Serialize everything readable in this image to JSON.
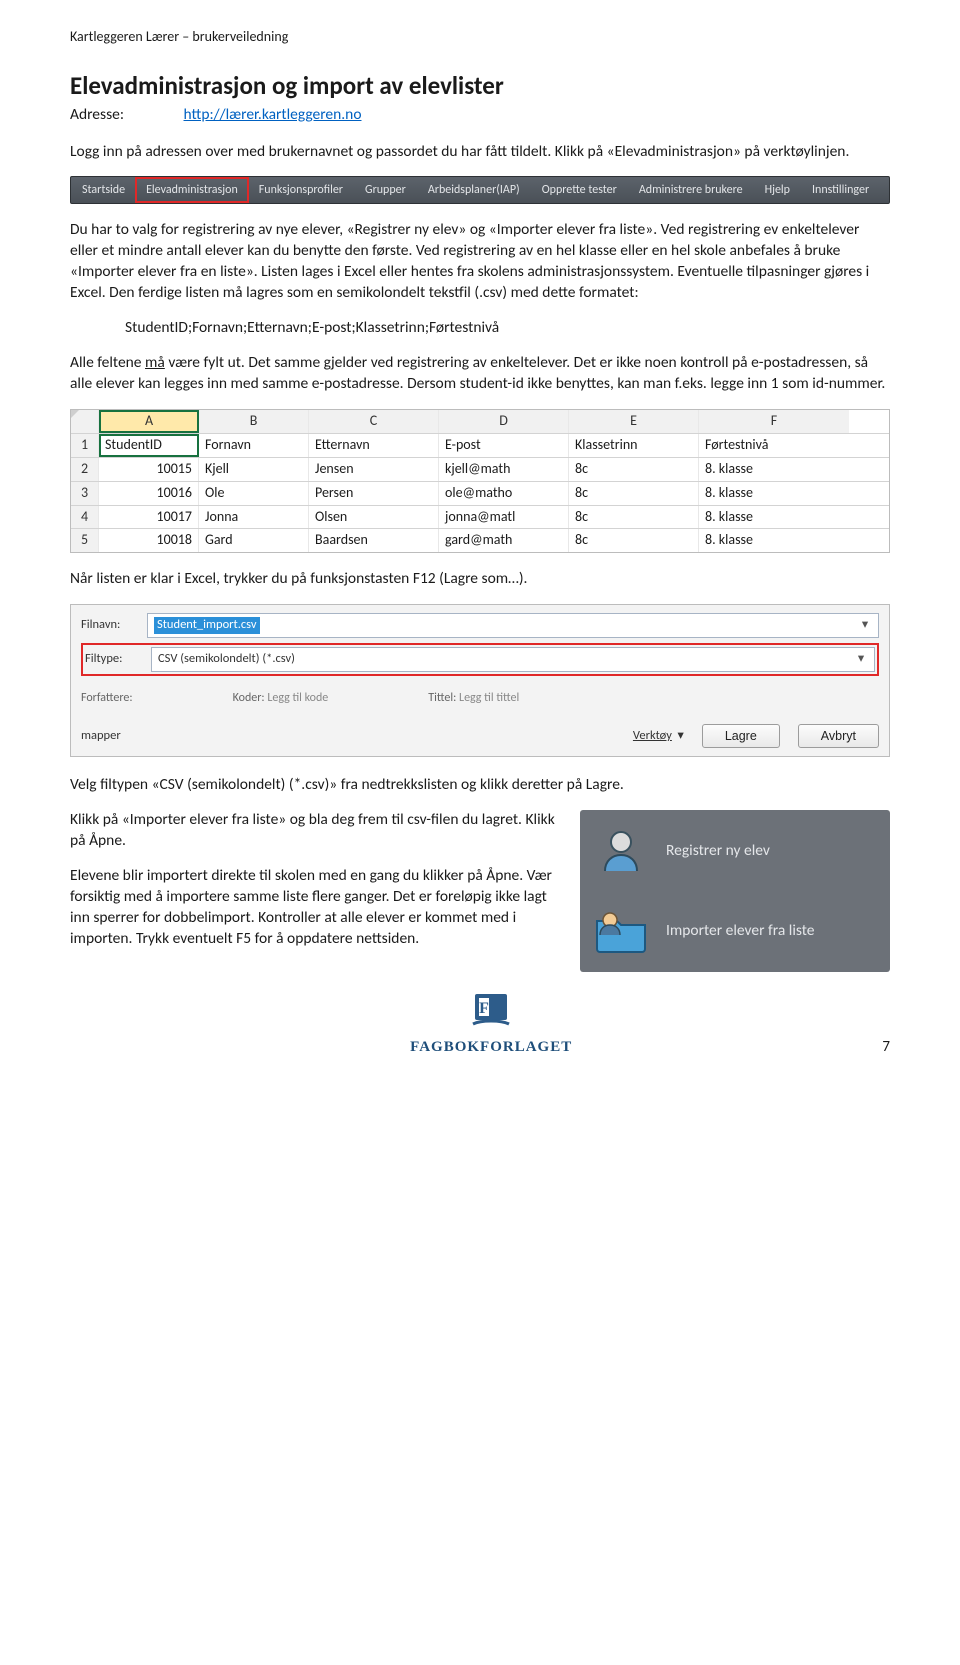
{
  "doc": {
    "header": "Kartleggeren Lærer – brukerveiledning",
    "title": "Elevadministrasjon og import av elevlister",
    "addr_label": "Adresse:",
    "addr_url": "http://lærer.kartleggeren.no",
    "intro": "Logg inn på adressen over med brukernavnet og passordet du har fått tildelt. Klikk på «Elevadministrasjon» på verktøylinjen."
  },
  "toolbar": {
    "items": [
      "Startside",
      "Elevadministrasjon",
      "Funksjonsprofiler",
      "Grupper",
      "Arbeidsplaner(IAP)",
      "Opprette tester",
      "Administrere brukere",
      "Hjelp",
      "Innstillinger"
    ]
  },
  "para1": "Du har to valg for registrering av nye elever, «Registrer ny elev» og «Importer elever fra liste». Ved registrering ev enkeltelever eller et mindre antall elever kan du benytte den første. Ved registrering av en hel klasse eller en hel skole anbefales å bruke «Importer elever fra en liste». Listen lages i Excel eller hentes fra skolens administrasjonssystem. Eventuelle tilpasninger gjøres i Excel. Den ferdige listen må lagres som en semikolondelt tekstfil (.csv) med dette formatet:",
  "csvline": "StudentID;Fornavn;Etternavn;E-post;Klassetrinn;Førtestnivå",
  "para2_a": "Alle feltene ",
  "para2_u": "må",
  "para2_b": " være fylt ut. Det samme gjelder ved registrering av enkeltelever. Det er ikke noen kontroll på e-postadressen, så alle elever kan legges inn med samme e-postadresse. Dersom student-id ikke benyttes, kan man f.eks. legge inn 1 som id-nummer.",
  "excel": {
    "cols": [
      "A",
      "B",
      "C",
      "D",
      "E",
      "F"
    ],
    "header": [
      "StudentID",
      "Fornavn",
      "Etternavn",
      "E-post",
      "Klassetrinn",
      "Førtestnivå"
    ],
    "rows": [
      [
        "10015",
        "Kjell",
        "Jensen",
        "kjell@math",
        "8c",
        "8. klasse"
      ],
      [
        "10016",
        "Ole",
        "Persen",
        "ole@matho",
        "8c",
        "8. klasse"
      ],
      [
        "10017",
        "Jonna",
        "Olsen",
        "jonna@matl",
        "8c",
        "8. klasse"
      ],
      [
        "10018",
        "Gard",
        "Baardsen",
        "gard@math",
        "8c",
        "8. klasse"
      ]
    ]
  },
  "para3": "Når listen er klar i Excel, trykker du på funksjonstasten F12 (Lagre som…).",
  "savedlg": {
    "filnavn_label": "Filnavn:",
    "filnavn_value": "Student_import.csv",
    "filtype_label": "Filtype:",
    "filtype_value": "CSV (semikolondelt) (*.csv)",
    "authors_lbl": "Forfattere:",
    "koder_lbl": "Koder:",
    "koder_val": "Legg til kode",
    "tittel_lbl": "Tittel:",
    "tittel_val": "Legg til tittel",
    "mapper": "mapper",
    "verktoy": "Verktøy",
    "lagre": "Lagre",
    "avbryt": "Avbryt"
  },
  "para4": "Velg filtypen «CSV (semikolondelt) (*.csv)» fra nedtrekkslisten og klikk deretter på Lagre.",
  "split": {
    "p1": "Klikk på «Importer elever fra liste» og bla deg frem til csv-filen du lagret. Klikk på Åpne.",
    "p2": "Elevene blir importert direkte til skolen med en gang du klikker på Åpne. Vær forsiktig med å importere samme liste flere ganger. Det er foreløpig ikke lagt inn sperrer for dobbelimport. Kontroller at alle elever er kommet med i importen. Trykk eventuelt F5 for å oppdatere nettsiden."
  },
  "panel": {
    "item1": "Registrer ny elev",
    "item2": "Importer elever fra liste"
  },
  "footer": {
    "brand": "FAGBOKFORLAGET",
    "page": "7"
  }
}
